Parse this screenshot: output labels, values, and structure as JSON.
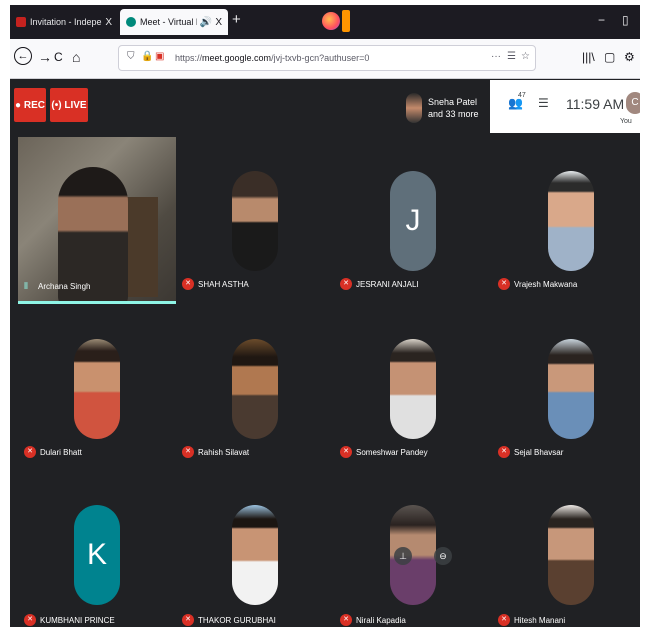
{
  "browser": {
    "tabs": [
      {
        "title": "Invitation - Independence Day",
        "close": "X",
        "favicon_color": "#c5221f"
      },
      {
        "title": "Meet - Virtual Patriotic Poe",
        "close": "X",
        "favicon_color": "#00897b",
        "audio": "🔊"
      }
    ],
    "new_tab": "+",
    "window_minimize": "−",
    "window_restore": "▯",
    "nav": {
      "back": "←",
      "forward": "→",
      "reload": "C",
      "home": "⌂"
    },
    "url": {
      "prefix": "https://",
      "domain": "meet.google.com",
      "path": "/jvj-txvb-gcn?authuser=0",
      "more": "···",
      "pocket": "☰",
      "star": "☆"
    },
    "right_icons": {
      "library": "|||\\",
      "sidebar": "▢",
      "account": "⚙"
    }
  },
  "meet": {
    "rec_label": "● REC",
    "live_label": "(•) LIVE",
    "presenter": {
      "line1": "Sneha Patel",
      "line2": "and 33 more"
    },
    "people_count": "47",
    "time": "11:59 AM",
    "self_initial": "C",
    "self_label": "You"
  },
  "participants": [
    {
      "name": "Archana Singh",
      "type": "video"
    },
    {
      "name": "SHAH ASTHA",
      "type": "photo",
      "color": "#5c4b3f"
    },
    {
      "name": "JESRANI ANJALI",
      "type": "letter",
      "letter": "J",
      "color": "#5f6f7a"
    },
    {
      "name": "Vrajesh Makwana",
      "type": "photo",
      "color": "#d7dde0"
    },
    {
      "name": "Dulari Bhatt",
      "type": "photo",
      "color": "#b98a6a"
    },
    {
      "name": "Rahish Silavat",
      "type": "photo",
      "color": "#7a5a3a"
    },
    {
      "name": "Someshwar Pandey",
      "type": "photo",
      "color": "#c9c2b6"
    },
    {
      "name": "Sejal Bhavsar",
      "type": "photo",
      "color": "#9fb3c6"
    },
    {
      "name": "KUMBHANI PRINCE",
      "type": "letter",
      "letter": "K",
      "color": "#00838f"
    },
    {
      "name": "THAKOR GURUBHAI",
      "type": "photo",
      "color": "#8fb6d6"
    },
    {
      "name": "Nirali Kapadia",
      "type": "photo",
      "color": "#4d4a46"
    },
    {
      "name": "Hitesh Manani",
      "type": "photo",
      "color": "#e6e2de"
    }
  ],
  "mic_icon": "✕",
  "speaking_icon": "⦀"
}
